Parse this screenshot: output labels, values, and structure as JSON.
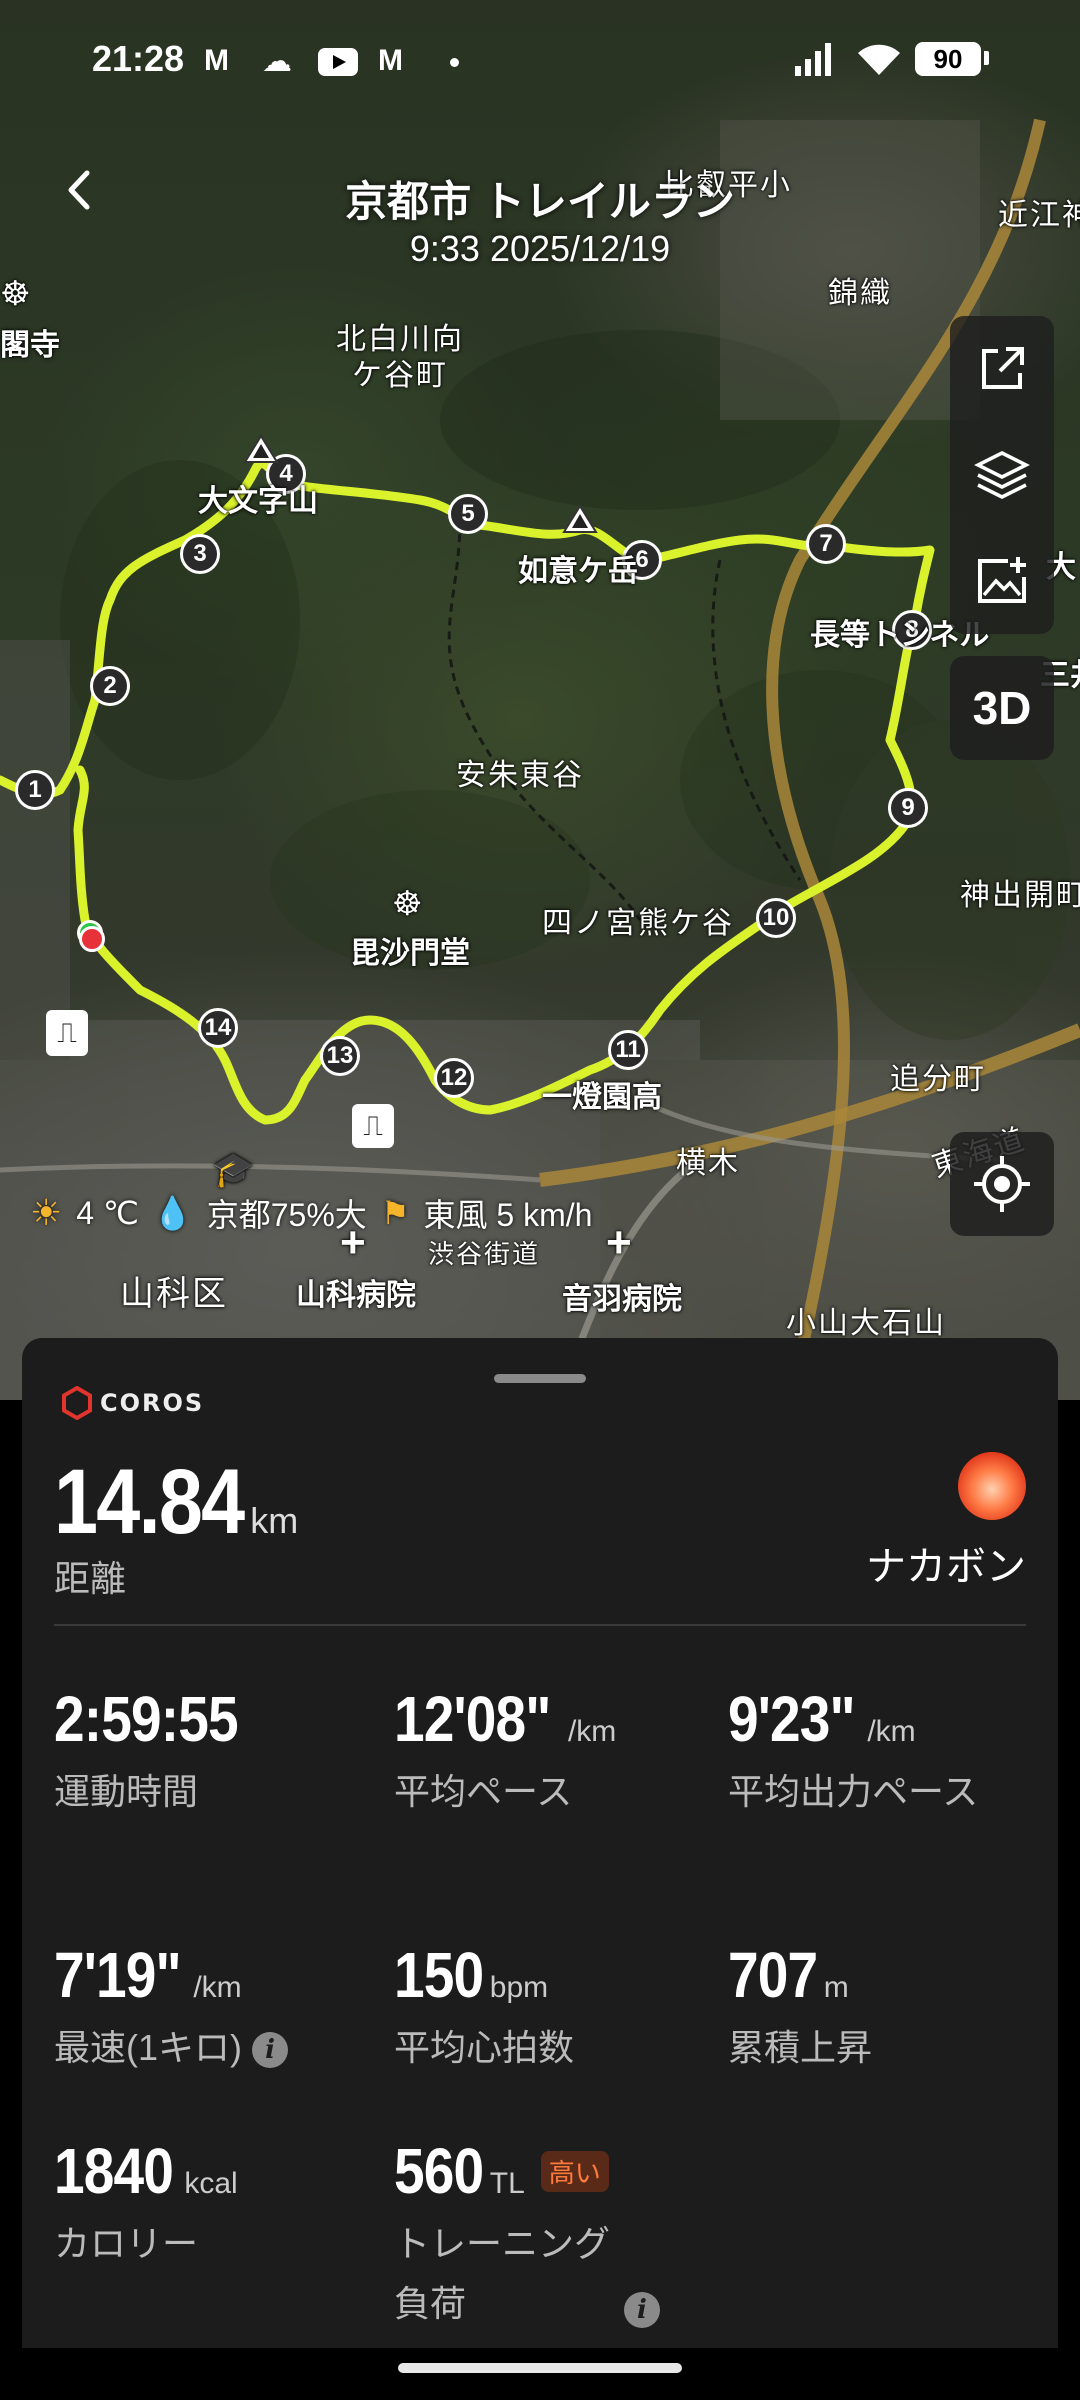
{
  "status_bar": {
    "time": "21:28",
    "battery": "90",
    "icons": [
      "gmail-icon",
      "weather-icon",
      "youtube-icon",
      "gmail-icon",
      "dot-icon",
      "signal-icon",
      "wifi-icon",
      "battery-icon"
    ]
  },
  "header": {
    "title": "京都市 トレイルラン",
    "subtitle": "9:33 2025/12/19"
  },
  "map": {
    "labels": {
      "kita_shirakawa": "北白川向\nケ谷町",
      "daimonji": "大文字山",
      "nyoigatake": "如意ケ岳",
      "nagara_tunnel": "長等トンネル",
      "anshu": "安朱東谷",
      "bishamondo": "毘沙門堂",
      "shinomiya": "四ノ宮熊ケ谷",
      "ittoen": "一燈園高",
      "yokoki": "横木",
      "oiwake": "追分町",
      "kamide": "神出開町",
      "nishiki": "錦織",
      "omi": "近江神",
      "hieidaira": "比叡平小",
      "temple_left": "閣寺",
      "yamashina_ku": "山科区",
      "yamashina_hospital": "山科病院",
      "otowa_hospital": "音羽病院",
      "shibutani": "渋谷街道",
      "koyama": "小山大石山",
      "tokaido": "東海道",
      "mii": "三井",
      "o": "大"
    },
    "markers": [
      "1",
      "2",
      "3",
      "4",
      "5",
      "6",
      "7",
      "8",
      "9",
      "10",
      "11",
      "12",
      "13",
      "14"
    ],
    "route_color": "#d9f22b",
    "weather": {
      "temperature": "4 ℃",
      "humidity": "京都75%大",
      "wind": "東風 5 km/h"
    },
    "controls": {
      "btn_3d": "3D"
    }
  },
  "panel": {
    "brand": "COROS",
    "distance": {
      "value": "14.84",
      "unit": "km",
      "label": "距離"
    },
    "user": {
      "name": "ナカボン"
    },
    "stats": [
      {
        "value": "2:59:55",
        "unit": "",
        "label": "運動時間"
      },
      {
        "value": "12'08\"",
        "unit": "/km",
        "label": "平均ペース"
      },
      {
        "value": "9'23\"",
        "unit": "/km",
        "label": "平均出力ペース"
      },
      {
        "value": "7'19\"",
        "unit": "/km",
        "label": "最速(1キロ)"
      },
      {
        "value": "150",
        "unit": "bpm",
        "label": "平均心拍数"
      },
      {
        "value": "707",
        "unit": "m",
        "label": "累積上昇"
      },
      {
        "value": "1840",
        "unit": "kcal",
        "label": "カロリー"
      },
      {
        "value": "560",
        "unit": "TL",
        "label": "トレーニング負荷",
        "badge": "高い"
      }
    ]
  }
}
